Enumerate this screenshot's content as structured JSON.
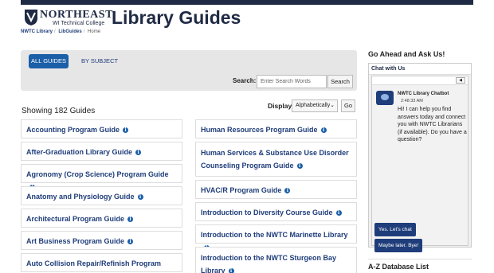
{
  "logo": {
    "name": "NORTHEAST",
    "sub": "WI Technical College"
  },
  "site_title": "Library Guides",
  "breadcrumb": [
    "NWTC Library",
    "LibGuides",
    "Home"
  ],
  "tabs": {
    "all": "ALL GUIDES",
    "subject": "BY SUBJECT"
  },
  "search": {
    "label": "Search:",
    "placeholder": "Enter Search Words",
    "button": "Search"
  },
  "showing": "Showing 182 Guides",
  "display": {
    "label": "Display",
    "selected": "Alphabetically",
    "go": "Go"
  },
  "guides_left": [
    "Accounting Program Guide",
    "After-Graduation Library Guide",
    "Agronomy (Crop Science) Program Guide",
    "Anatomy and Physiology Guide",
    "Architectural Program Guide",
    "Art Business Program Guide",
    "Auto Collision Repair/Refinish Program Guide"
  ],
  "guides_right": [
    "Human Resources Program Guide",
    "Human Services & Substance Use Disorder Counseling Program Guide",
    "HVAC/R Program Guide",
    "Introduction to Diversity Course Guide",
    "Introduction to the NWTC Marinette Library",
    "Introduction to the NWTC Sturgeon Bay Library"
  ],
  "sidebar": {
    "heading": "Go Ahead and Ask Us!",
    "chat_header": "Chat with Us",
    "bot_name": "NWTC Library Chatbot",
    "bot_time": "2:48:33 AM",
    "bot_message": "Hi! I can help you find answers today and connect you with NWTC Librarians (if available). Do you have a question?",
    "yes_button": "Yes. Let's chat",
    "no_button": "Maybe later. Bye!",
    "az_heading": "A-Z Database List"
  },
  "colors": {
    "navy": "#1f2a44",
    "link": "#1f3d7a",
    "accent": "#1a5fa8"
  }
}
